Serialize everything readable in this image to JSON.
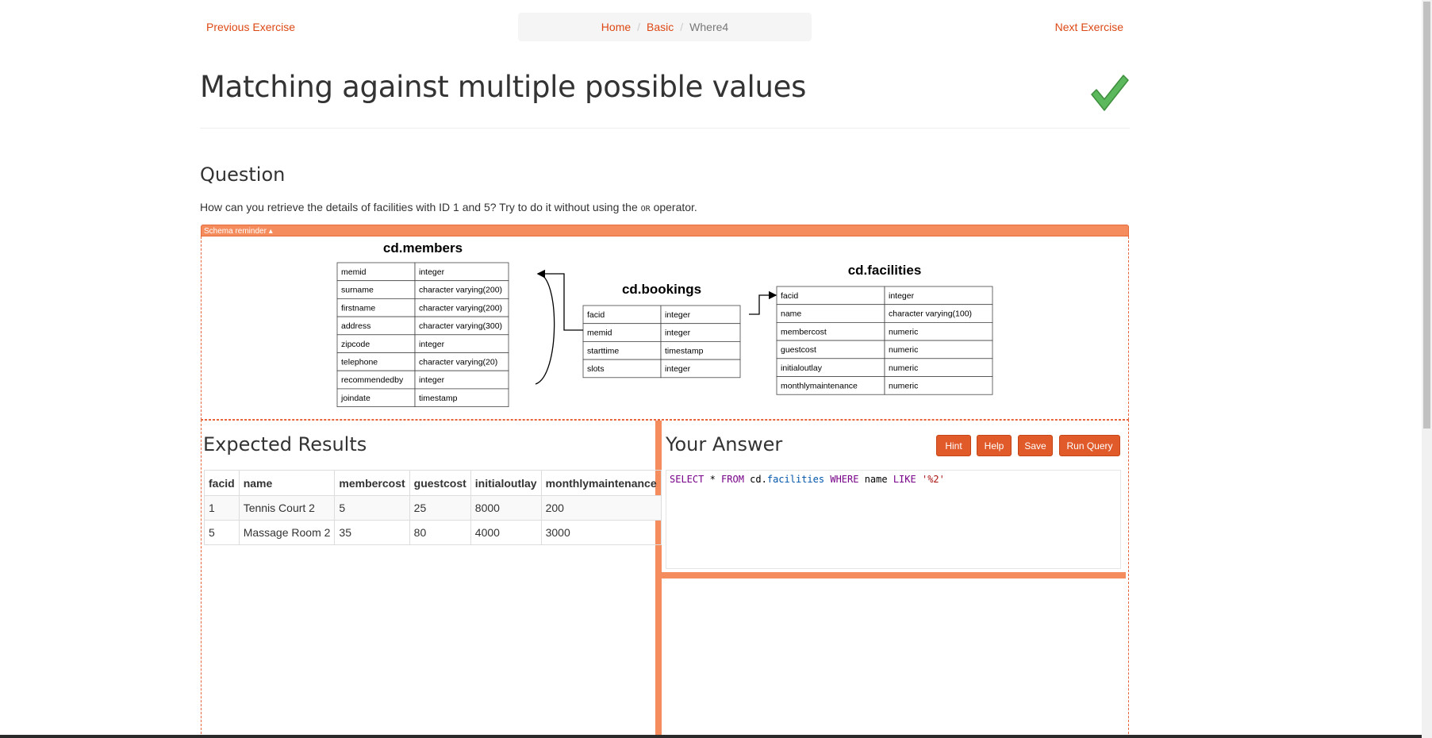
{
  "nav": {
    "previous_label": "Previous Exercise",
    "next_label": "Next Exercise",
    "breadcrumb": {
      "home": "Home",
      "section": "Basic",
      "current": "Where4"
    }
  },
  "page": {
    "title": "Matching against multiple possible values",
    "completed": true
  },
  "question": {
    "heading": "Question",
    "text_before": "How can you retrieve the details of facilities with ID 1 and 5? Try to do it without using the",
    "code": "OR",
    "text_after": "operator."
  },
  "schema": {
    "toggle_label": "Schema reminder ▴",
    "tables": [
      {
        "name": "cd.members",
        "columns": [
          [
            "memid",
            "integer"
          ],
          [
            "surname",
            "character varying(200)"
          ],
          [
            "firstname",
            "character varying(200)"
          ],
          [
            "address",
            "character varying(300)"
          ],
          [
            "zipcode",
            "integer"
          ],
          [
            "telephone",
            "character varying(20)"
          ],
          [
            "recommendedby",
            "integer"
          ],
          [
            "joindate",
            "timestamp"
          ]
        ]
      },
      {
        "name": "cd.bookings",
        "columns": [
          [
            "facid",
            "integer"
          ],
          [
            "memid",
            "integer"
          ],
          [
            "starttime",
            "timestamp"
          ],
          [
            "slots",
            "integer"
          ]
        ]
      },
      {
        "name": "cd.facilities",
        "columns": [
          [
            "facid",
            "integer"
          ],
          [
            "name",
            "character varying(100)"
          ],
          [
            "membercost",
            "numeric"
          ],
          [
            "guestcost",
            "numeric"
          ],
          [
            "initialoutlay",
            "numeric"
          ],
          [
            "monthlymaintenance",
            "numeric"
          ]
        ]
      }
    ]
  },
  "expected": {
    "heading": "Expected Results",
    "columns": [
      "facid",
      "name",
      "membercost",
      "guestcost",
      "initialoutlay",
      "monthlymaintenance"
    ],
    "rows": [
      [
        "1",
        "Tennis Court 2",
        "5",
        "25",
        "8000",
        "200"
      ],
      [
        "5",
        "Massage Room 2",
        "35",
        "80",
        "4000",
        "3000"
      ]
    ]
  },
  "answer": {
    "heading": "Your Answer",
    "buttons": {
      "hint": "Hint",
      "help": "Help",
      "save": "Save",
      "run": "Run Query"
    },
    "query_tokens": [
      {
        "t": "SELECT",
        "c": "kw"
      },
      {
        "t": " * ",
        "c": "plain"
      },
      {
        "t": "FROM",
        "c": "kw"
      },
      {
        "t": " cd.",
        "c": "plain"
      },
      {
        "t": "facilities",
        "c": "prop"
      },
      {
        "t": " ",
        "c": "plain"
      },
      {
        "t": "WHERE",
        "c": "kw"
      },
      {
        "t": " name ",
        "c": "plain"
      },
      {
        "t": "LIKE",
        "c": "kw"
      },
      {
        "t": " ",
        "c": "plain"
      },
      {
        "t": "'%2'",
        "c": "str"
      }
    ]
  },
  "colors": {
    "accent": "#dd4814",
    "splitter": "#f58c5e",
    "check": "#5cb85c"
  }
}
